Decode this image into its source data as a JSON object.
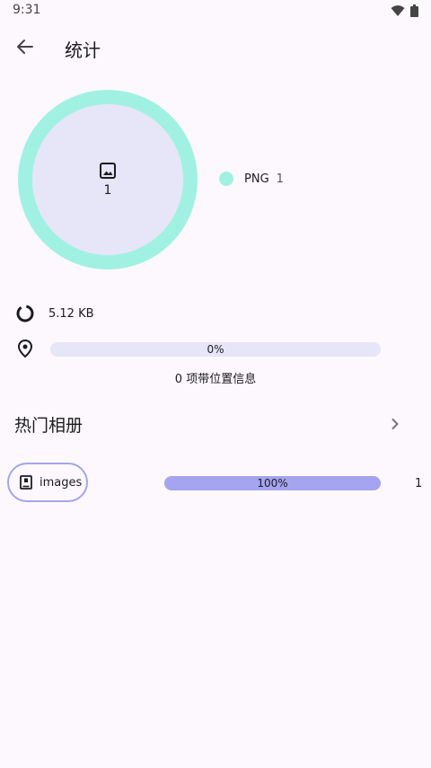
{
  "status_bar": {
    "time": "9:31"
  },
  "app_bar": {
    "title": "统计"
  },
  "chart_data": {
    "type": "pie",
    "center_count": "1",
    "slices": [
      {
        "label": "PNG",
        "value": 1,
        "color": "#a1f1e3"
      }
    ]
  },
  "legend": [
    {
      "label": "PNG",
      "value": "1",
      "color": "#a1f1e3"
    }
  ],
  "storage": {
    "size": "5.12 KB"
  },
  "location": {
    "percent_text": "0%",
    "fraction": 0,
    "caption": "0 项带位置信息"
  },
  "section": {
    "title": "热门相册"
  },
  "albums": [
    {
      "name": "images",
      "percent_text": "100%",
      "fraction": 1,
      "count": "1"
    }
  ],
  "colors": {
    "accent": "#a4a4f0",
    "background": "#fdf8fd",
    "track": "#e7e5f8",
    "png": "#a1f1e3"
  }
}
